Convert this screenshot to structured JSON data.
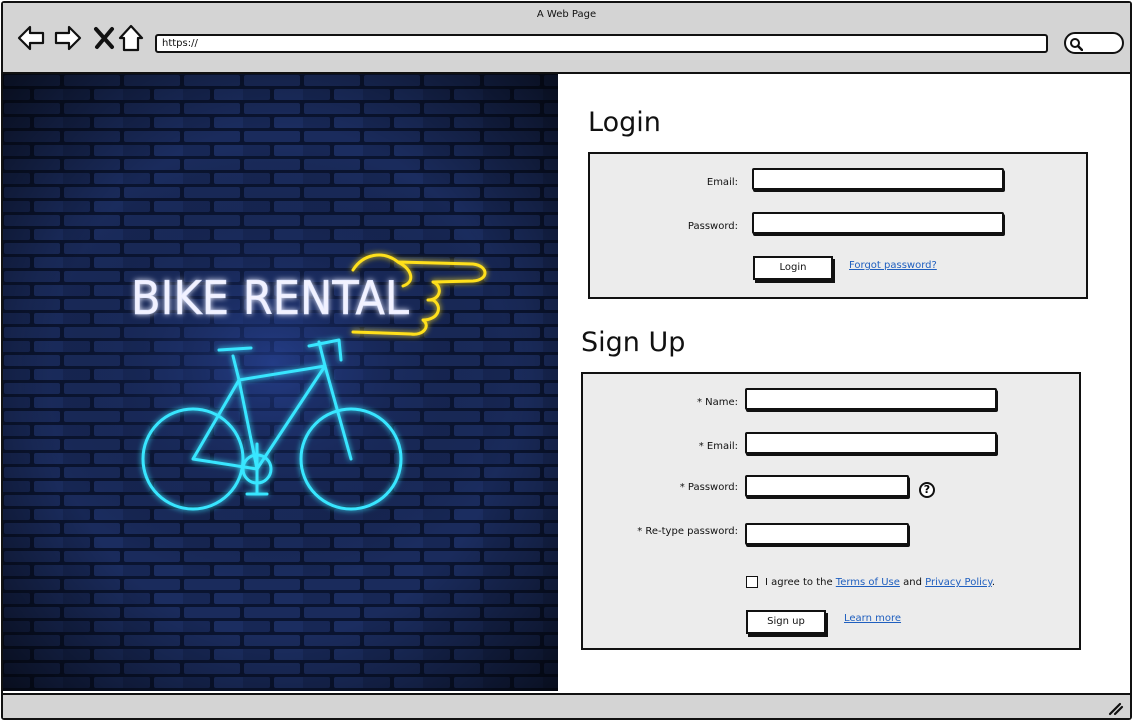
{
  "window": {
    "title": "A Web Page"
  },
  "browser": {
    "address": "https://",
    "icons": [
      "back-arrow-icon",
      "forward-arrow-icon",
      "close-icon",
      "home-icon",
      "search-icon"
    ]
  },
  "hero": {
    "sign_text": "BIKE RENTAL",
    "colors": {
      "neon_text": "#f2f2ff",
      "neon_hand": "#ffe01a",
      "neon_bike": "#39e6ff",
      "wall": "#0b1530"
    }
  },
  "login": {
    "heading": "Login",
    "email_label": "Email:",
    "password_label": "Password:",
    "login_button": "Login",
    "forgot_link": "Forgot password?"
  },
  "signup": {
    "heading": "Sign Up",
    "name_label": "* Name:",
    "email_label": "* Email:",
    "password_label": "* Password:",
    "retype_label": "* Re-type password:",
    "help_icon": "?",
    "agree_prefix": "I agree to the",
    "terms_link": "Terms of Use",
    "agree_and": "and",
    "privacy_link": "Privacy Policy",
    "agree_suffix": ".",
    "signup_button": "Sign up",
    "learn_more_link": "Learn more"
  }
}
